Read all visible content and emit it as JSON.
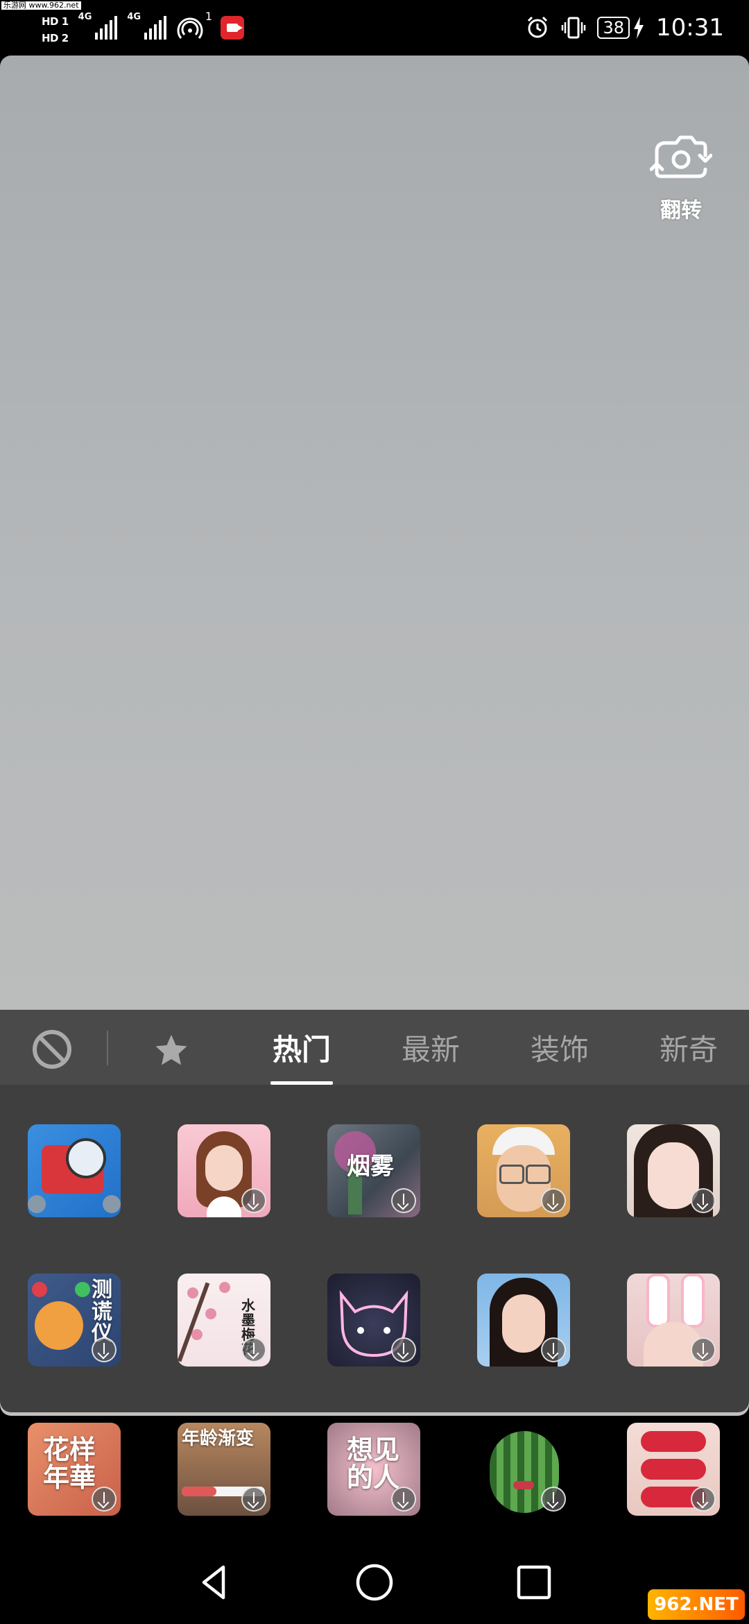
{
  "status_bar": {
    "watermark": "乐游网 www.962.net",
    "sim1": "HD 1",
    "sim2": "HD 2",
    "net1": "4G",
    "net2": "4G",
    "hotspot_count": "1",
    "battery": "38",
    "time": "10:31"
  },
  "camera": {
    "flip_label": "翻转"
  },
  "effects_panel": {
    "tabs": [
      {
        "label": "热门",
        "active": true
      },
      {
        "label": "最新",
        "active": false
      },
      {
        "label": "装饰",
        "active": false
      },
      {
        "label": "新奇",
        "active": false
      }
    ],
    "row1": [
      {
        "name": "robot-effect",
        "label": ""
      },
      {
        "name": "cartoon-girl-effect",
        "label": ""
      },
      {
        "name": "smoke-effect",
        "label": "烟雾"
      },
      {
        "name": "glasses-boy-effect",
        "label": ""
      },
      {
        "name": "girl-portrait-effect",
        "label": ""
      }
    ],
    "row2": [
      {
        "name": "lie-detector-effect",
        "label": "测谎仪"
      },
      {
        "name": "ink-flower-effect",
        "label": "水墨梅花"
      },
      {
        "name": "neon-cat-effect",
        "label": ""
      },
      {
        "name": "hearts-girl-effect",
        "label": ""
      },
      {
        "name": "bunny-ears-effect",
        "label": ""
      }
    ],
    "row3": [
      {
        "name": "blossom-years-effect",
        "label": "花样年華"
      },
      {
        "name": "age-change-effect",
        "label": "年龄渐变"
      },
      {
        "name": "want-to-see-effect",
        "label": "想见的人"
      },
      {
        "name": "watermelon-effect",
        "label": ""
      },
      {
        "name": "lips-effect",
        "label": ""
      }
    ]
  },
  "site_watermark": "962.NET"
}
